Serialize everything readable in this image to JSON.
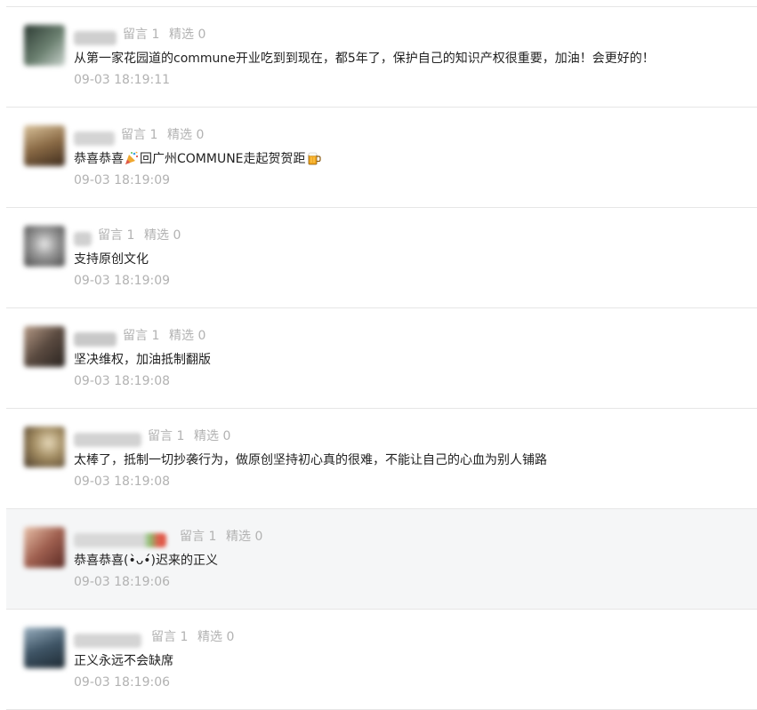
{
  "stat_labels": {
    "reply": "留言",
    "selected": "精选"
  },
  "comments": [
    {
      "avatar_color": "#4a5a52",
      "reply_count": "1",
      "selected_count": "0",
      "text": "从第一家花园道的commune开业吃到到现在，都5年了，保护自己的知识产权很重要，加油！会更好的！",
      "time": "09-03 18:19:11"
    },
    {
      "avatar_color": "#8a6a45",
      "reply_count": "1",
      "selected_count": "0",
      "text_parts": [
        "恭喜恭喜",
        "回广州COMMUNE走起贺贺距"
      ],
      "time": "09-03 18:19:09"
    },
    {
      "avatar_color": "#6d6d6d",
      "reply_count": "1",
      "selected_count": "0",
      "text": "支持原创文化",
      "time": "09-03 18:19:09"
    },
    {
      "avatar_color": "#5a4a40",
      "reply_count": "1",
      "selected_count": "0",
      "text": "坚决维权，加油抵制翻版",
      "time": "09-03 18:19:08"
    },
    {
      "avatar_color": "#7a6a4a",
      "reply_count": "1",
      "selected_count": "0",
      "text": "太棒了，抵制一切抄袭行为，做原创坚持初心真的很难，不能让自己的心血为别人铺路",
      "time": "09-03 18:19:08"
    },
    {
      "avatar_color": "#a06050",
      "reply_count": "1",
      "selected_count": "0",
      "text": "恭喜恭喜(•̀ᴗ•́)迟来的正义",
      "time": "09-03 18:19:06"
    },
    {
      "avatar_color": "#3f5566",
      "reply_count": "1",
      "selected_count": "0",
      "text": "正义永远不会缺席",
      "time": "09-03 18:19:06"
    }
  ],
  "icons": [
    "party-popper-emoji-icon",
    "beer-mug-emoji-icon"
  ],
  "colors": {
    "divider": "#e6e6e6",
    "meta_gray": "#b2b2b2",
    "text": "#222222",
    "hover_row": "#f5f6f7"
  }
}
